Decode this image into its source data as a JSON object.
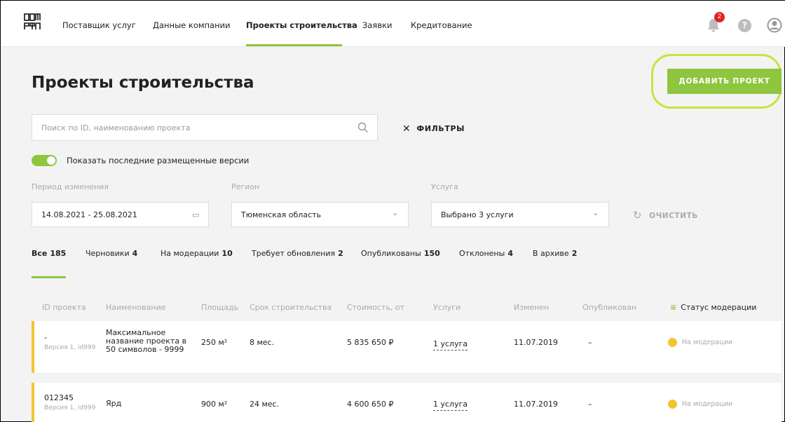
{
  "header": {
    "logo_text": "ДОМ РФ",
    "nav": [
      "Поставщик услуг",
      "Данные компании",
      "Проекты строительства",
      "Заявки",
      "Кредитование"
    ],
    "notifications_count": "2",
    "help_label": "?"
  },
  "page": {
    "title": "Проекты строительства",
    "add_button": "ДОБАВИТЬ ПРОЕКТ"
  },
  "search": {
    "placeholder": "Поиск по ID, наименованию проекта",
    "filters_label": "ФИЛЬТРЫ",
    "filters_icon": "✕"
  },
  "toggle": {
    "label": "Показать последние размещенные версии",
    "on": true
  },
  "filters": {
    "period_label": "Период изменения",
    "period_value": "14.08.2021 - 25.08.2021",
    "region_label": "Регион",
    "region_value": "Тюменская область",
    "service_label": "Услуга",
    "service_value": "Выбрано 3 услуги",
    "clear_label": "ОЧИСТИТЬ",
    "chevron": "⌄",
    "calendar_icon": "▭",
    "clear_icon": "↻"
  },
  "tabs": [
    {
      "label": "Все",
      "count": "185"
    },
    {
      "label": "Черновики",
      "count": "4"
    },
    {
      "label": "На модерации",
      "count": "10"
    },
    {
      "label": "Требует обновления",
      "count": "2"
    },
    {
      "label": "Опубликованы",
      "count": "150"
    },
    {
      "label": "Отклонены",
      "count": "4"
    },
    {
      "label": "В архиве",
      "count": "2"
    }
  ],
  "table": {
    "columns": [
      "ID проекта",
      "Наименование",
      "Площадь",
      "Срок строительства",
      "Стоимость, от",
      "Услуги",
      "Изменен",
      "Опубликован",
      "Статус модерации"
    ],
    "filter_icon": "≡",
    "rows": [
      {
        "id": "-",
        "version": "Версия 1, id999",
        "name": "Максимальное название проекта в 50 символов - 9999",
        "area": "250 м²",
        "term": "8 мес.",
        "price": "5 835 650 ₽",
        "services": "1 услуга",
        "changed": "11.07.2019",
        "published": "–",
        "status": "На модерации"
      },
      {
        "id": "012345",
        "version": "Версия 1, id999",
        "name": "Ярд",
        "area": "900 м²",
        "term": "24 мес.",
        "price": "4 600 650 ₽",
        "services": "1 услуга",
        "changed": "11.07.2019",
        "published": "–",
        "status": "На модерации"
      }
    ]
  },
  "colors": {
    "accent": "#8ec63f",
    "highlight": "#c9e33b",
    "status_yellow": "#f4c430",
    "badge_red": "#e02424"
  }
}
